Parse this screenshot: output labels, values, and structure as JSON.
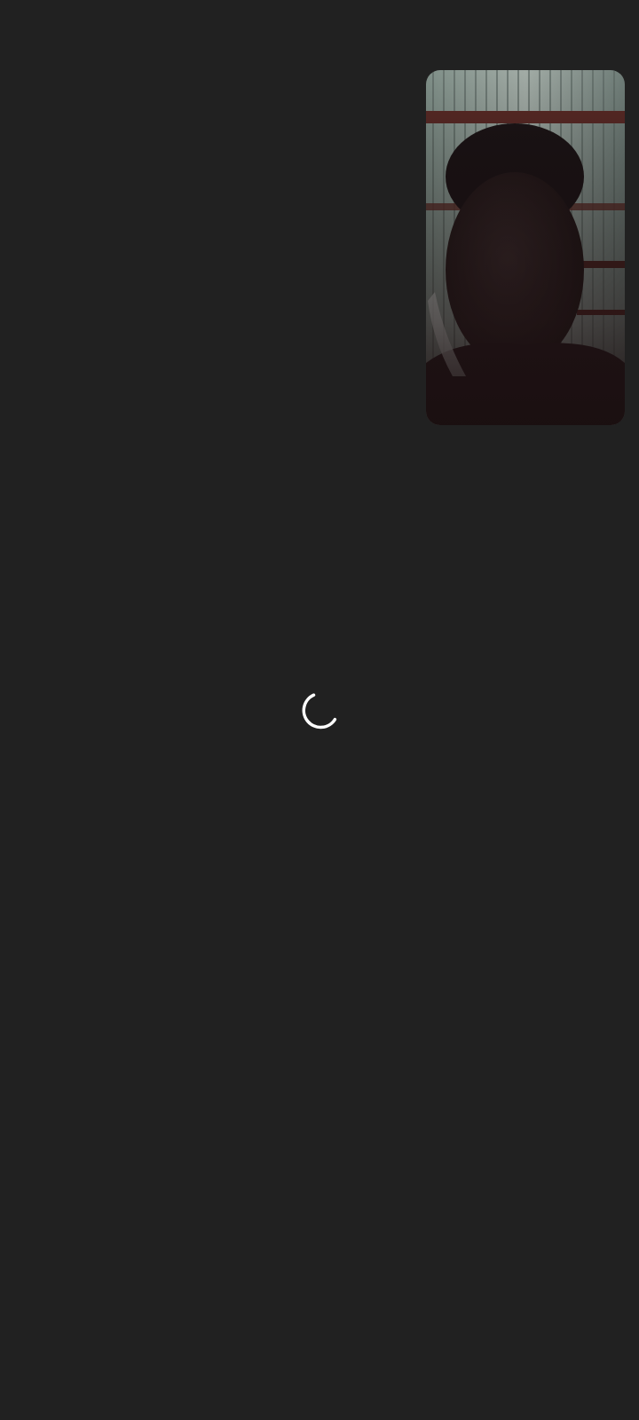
{
  "call": {
    "state": "connecting",
    "loading_indicator": "spinner-icon"
  },
  "self_view": {
    "icon": "camera-preview",
    "description_visible": false
  },
  "colors": {
    "background": "#212121",
    "spinner": "#ffffff",
    "self_view_dark": "#1a1112",
    "self_view_wall": "#8e9a93",
    "self_view_beam": "#5a2a26"
  }
}
